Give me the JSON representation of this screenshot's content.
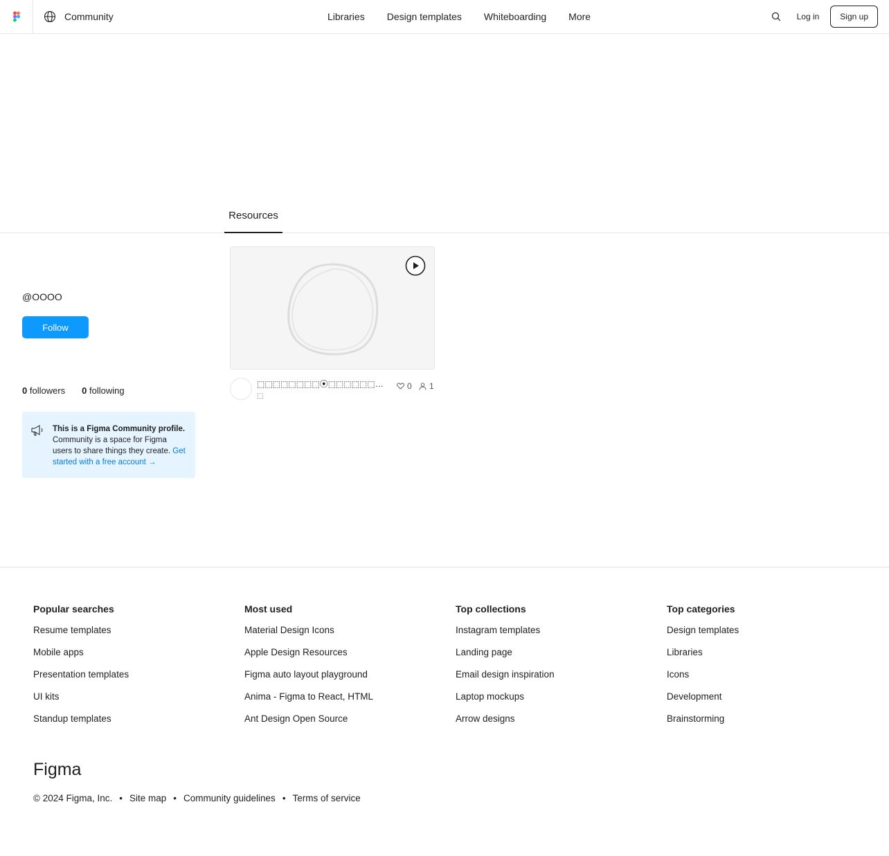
{
  "header": {
    "community_label": "Community",
    "nav": [
      "Libraries",
      "Design templates",
      "Whiteboarding",
      "More"
    ],
    "login_label": "Log in",
    "signup_label": "Sign up"
  },
  "tabs": {
    "resources": "Resources"
  },
  "profile": {
    "name": "",
    "handle": "@OOOO",
    "follow_label": "Follow",
    "bio": "",
    "followers_count": "0",
    "followers_label": "followers",
    "following_count": "0",
    "following_label": "following"
  },
  "info_box": {
    "title": "This is a Figma Community profile.",
    "text": "Community is a space for Figma users to share things they create.",
    "link": "Get started with a free account →"
  },
  "resource": {
    "title": "⬚⬚⬚⬚⬚⬚⬚⬚⦿⬚⬚⬚⬚⬚⬚⬚⬚⬚⬚⬚⬚⬚⬚...",
    "author": "⬚",
    "likes": "0",
    "users": "1"
  },
  "footer": {
    "columns": [
      {
        "heading": "Popular searches",
        "items": [
          "Resume templates",
          "Mobile apps",
          "Presentation templates",
          "UI kits",
          "Standup templates"
        ]
      },
      {
        "heading": "Most used",
        "items": [
          "Material Design Icons",
          "Apple Design Resources",
          "Figma auto layout playground",
          "Anima - Figma to React, HTML",
          "Ant Design Open Source"
        ]
      },
      {
        "heading": "Top collections",
        "items": [
          "Instagram templates",
          "Landing page",
          "Email design inspiration",
          "Laptop mockups",
          "Arrow designs"
        ]
      },
      {
        "heading": "Top categories",
        "items": [
          "Design templates",
          "Libraries",
          "Icons",
          "Development",
          "Brainstorming"
        ]
      }
    ],
    "wordmark": "Figma",
    "copyright": "© 2024 Figma, Inc.",
    "sitemap": "Site map",
    "guidelines": "Community guidelines",
    "terms": "Terms of service"
  },
  "colors": {
    "accent": "#0d99ff",
    "info_bg": "#e5f4ff",
    "link": "#007be5"
  }
}
